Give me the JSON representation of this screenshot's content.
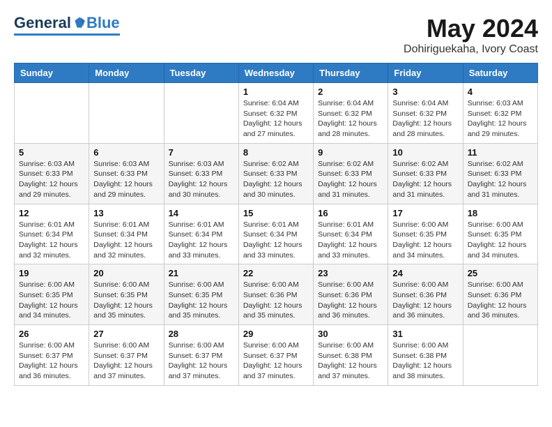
{
  "header": {
    "logo_general": "General",
    "logo_blue": "Blue",
    "month": "May 2024",
    "location": "Dohiriguekaha, Ivory Coast"
  },
  "weekdays": [
    "Sunday",
    "Monday",
    "Tuesday",
    "Wednesday",
    "Thursday",
    "Friday",
    "Saturday"
  ],
  "weeks": [
    [
      {
        "day": "",
        "sunrise": "",
        "sunset": "",
        "daylight": ""
      },
      {
        "day": "",
        "sunrise": "",
        "sunset": "",
        "daylight": ""
      },
      {
        "day": "",
        "sunrise": "",
        "sunset": "",
        "daylight": ""
      },
      {
        "day": "1",
        "sunrise": "Sunrise: 6:04 AM",
        "sunset": "Sunset: 6:32 PM",
        "daylight": "Daylight: 12 hours and 27 minutes."
      },
      {
        "day": "2",
        "sunrise": "Sunrise: 6:04 AM",
        "sunset": "Sunset: 6:32 PM",
        "daylight": "Daylight: 12 hours and 28 minutes."
      },
      {
        "day": "3",
        "sunrise": "Sunrise: 6:04 AM",
        "sunset": "Sunset: 6:32 PM",
        "daylight": "Daylight: 12 hours and 28 minutes."
      },
      {
        "day": "4",
        "sunrise": "Sunrise: 6:03 AM",
        "sunset": "Sunset: 6:32 PM",
        "daylight": "Daylight: 12 hours and 29 minutes."
      }
    ],
    [
      {
        "day": "5",
        "sunrise": "Sunrise: 6:03 AM",
        "sunset": "Sunset: 6:33 PM",
        "daylight": "Daylight: 12 hours and 29 minutes."
      },
      {
        "day": "6",
        "sunrise": "Sunrise: 6:03 AM",
        "sunset": "Sunset: 6:33 PM",
        "daylight": "Daylight: 12 hours and 29 minutes."
      },
      {
        "day": "7",
        "sunrise": "Sunrise: 6:03 AM",
        "sunset": "Sunset: 6:33 PM",
        "daylight": "Daylight: 12 hours and 30 minutes."
      },
      {
        "day": "8",
        "sunrise": "Sunrise: 6:02 AM",
        "sunset": "Sunset: 6:33 PM",
        "daylight": "Daylight: 12 hours and 30 minutes."
      },
      {
        "day": "9",
        "sunrise": "Sunrise: 6:02 AM",
        "sunset": "Sunset: 6:33 PM",
        "daylight": "Daylight: 12 hours and 31 minutes."
      },
      {
        "day": "10",
        "sunrise": "Sunrise: 6:02 AM",
        "sunset": "Sunset: 6:33 PM",
        "daylight": "Daylight: 12 hours and 31 minutes."
      },
      {
        "day": "11",
        "sunrise": "Sunrise: 6:02 AM",
        "sunset": "Sunset: 6:33 PM",
        "daylight": "Daylight: 12 hours and 31 minutes."
      }
    ],
    [
      {
        "day": "12",
        "sunrise": "Sunrise: 6:01 AM",
        "sunset": "Sunset: 6:34 PM",
        "daylight": "Daylight: 12 hours and 32 minutes."
      },
      {
        "day": "13",
        "sunrise": "Sunrise: 6:01 AM",
        "sunset": "Sunset: 6:34 PM",
        "daylight": "Daylight: 12 hours and 32 minutes."
      },
      {
        "day": "14",
        "sunrise": "Sunrise: 6:01 AM",
        "sunset": "Sunset: 6:34 PM",
        "daylight": "Daylight: 12 hours and 33 minutes."
      },
      {
        "day": "15",
        "sunrise": "Sunrise: 6:01 AM",
        "sunset": "Sunset: 6:34 PM",
        "daylight": "Daylight: 12 hours and 33 minutes."
      },
      {
        "day": "16",
        "sunrise": "Sunrise: 6:01 AM",
        "sunset": "Sunset: 6:34 PM",
        "daylight": "Daylight: 12 hours and 33 minutes."
      },
      {
        "day": "17",
        "sunrise": "Sunrise: 6:00 AM",
        "sunset": "Sunset: 6:35 PM",
        "daylight": "Daylight: 12 hours and 34 minutes."
      },
      {
        "day": "18",
        "sunrise": "Sunrise: 6:00 AM",
        "sunset": "Sunset: 6:35 PM",
        "daylight": "Daylight: 12 hours and 34 minutes."
      }
    ],
    [
      {
        "day": "19",
        "sunrise": "Sunrise: 6:00 AM",
        "sunset": "Sunset: 6:35 PM",
        "daylight": "Daylight: 12 hours and 34 minutes."
      },
      {
        "day": "20",
        "sunrise": "Sunrise: 6:00 AM",
        "sunset": "Sunset: 6:35 PM",
        "daylight": "Daylight: 12 hours and 35 minutes."
      },
      {
        "day": "21",
        "sunrise": "Sunrise: 6:00 AM",
        "sunset": "Sunset: 6:35 PM",
        "daylight": "Daylight: 12 hours and 35 minutes."
      },
      {
        "day": "22",
        "sunrise": "Sunrise: 6:00 AM",
        "sunset": "Sunset: 6:36 PM",
        "daylight": "Daylight: 12 hours and 35 minutes."
      },
      {
        "day": "23",
        "sunrise": "Sunrise: 6:00 AM",
        "sunset": "Sunset: 6:36 PM",
        "daylight": "Daylight: 12 hours and 36 minutes."
      },
      {
        "day": "24",
        "sunrise": "Sunrise: 6:00 AM",
        "sunset": "Sunset: 6:36 PM",
        "daylight": "Daylight: 12 hours and 36 minutes."
      },
      {
        "day": "25",
        "sunrise": "Sunrise: 6:00 AM",
        "sunset": "Sunset: 6:36 PM",
        "daylight": "Daylight: 12 hours and 36 minutes."
      }
    ],
    [
      {
        "day": "26",
        "sunrise": "Sunrise: 6:00 AM",
        "sunset": "Sunset: 6:37 PM",
        "daylight": "Daylight: 12 hours and 36 minutes."
      },
      {
        "day": "27",
        "sunrise": "Sunrise: 6:00 AM",
        "sunset": "Sunset: 6:37 PM",
        "daylight": "Daylight: 12 hours and 37 minutes."
      },
      {
        "day": "28",
        "sunrise": "Sunrise: 6:00 AM",
        "sunset": "Sunset: 6:37 PM",
        "daylight": "Daylight: 12 hours and 37 minutes."
      },
      {
        "day": "29",
        "sunrise": "Sunrise: 6:00 AM",
        "sunset": "Sunset: 6:37 PM",
        "daylight": "Daylight: 12 hours and 37 minutes."
      },
      {
        "day": "30",
        "sunrise": "Sunrise: 6:00 AM",
        "sunset": "Sunset: 6:38 PM",
        "daylight": "Daylight: 12 hours and 37 minutes."
      },
      {
        "day": "31",
        "sunrise": "Sunrise: 6:00 AM",
        "sunset": "Sunset: 6:38 PM",
        "daylight": "Daylight: 12 hours and 38 minutes."
      },
      {
        "day": "",
        "sunrise": "",
        "sunset": "",
        "daylight": ""
      }
    ]
  ]
}
